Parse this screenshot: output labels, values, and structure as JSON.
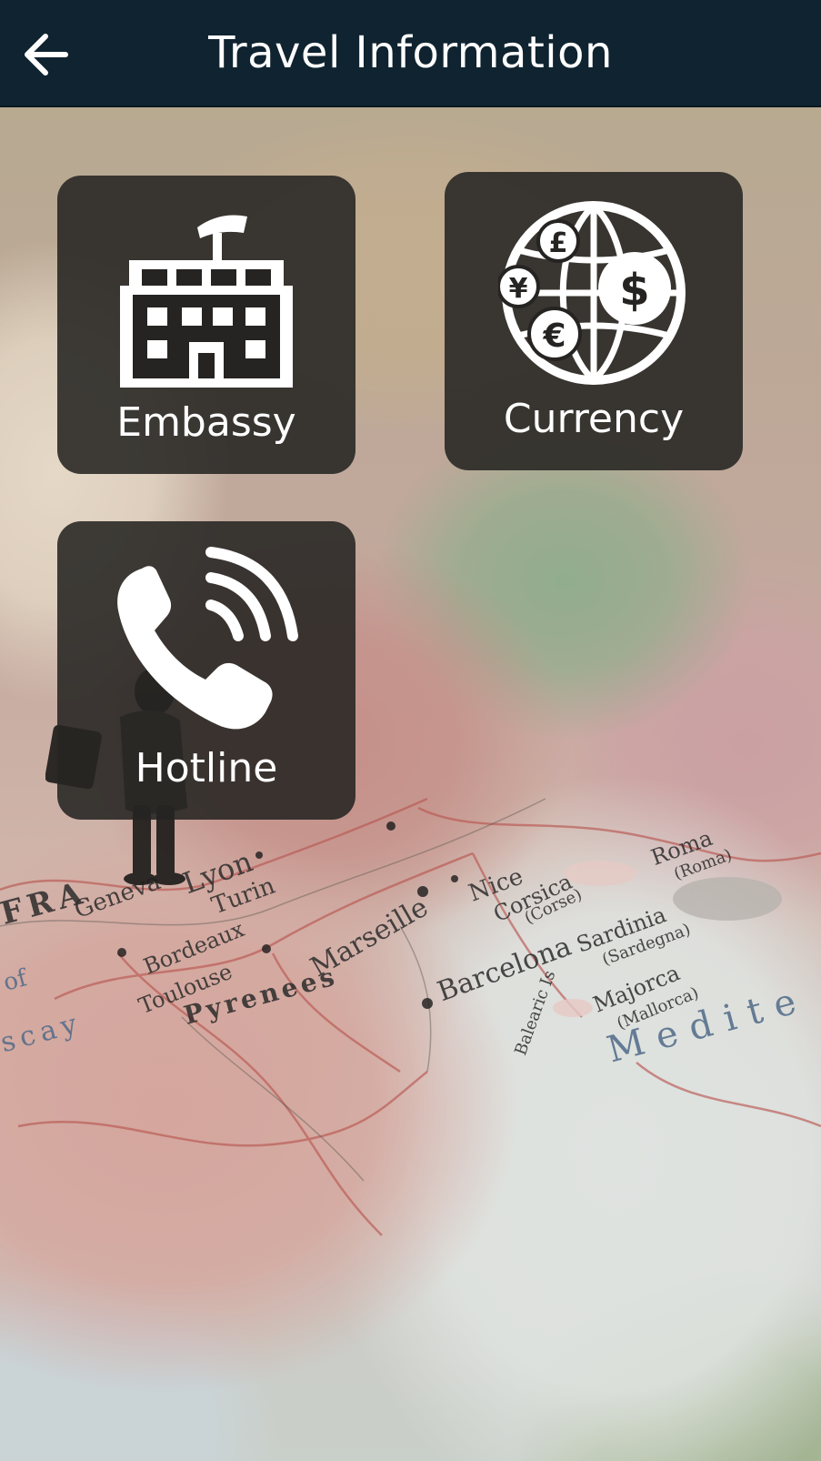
{
  "header": {
    "title": "Travel Information",
    "back_icon": "arrow-left-icon",
    "background_color": "#0f2330"
  },
  "tiles": [
    {
      "id": "embassy",
      "label": "Embassy",
      "icon": "building-icon"
    },
    {
      "id": "currency",
      "label": "Currency",
      "icon": "globe-currency-icon"
    },
    {
      "id": "hotline",
      "label": "Hotline",
      "icon": "phone-ringing-icon"
    }
  ],
  "background": {
    "map_labels": [
      "Geneva",
      "Lyon",
      "Turin",
      "Bordeaux",
      "Toulouse",
      "Marseille",
      "Nice",
      "Corsica",
      "(Corse)",
      "Barcelona",
      "Sardinia",
      "(Sardegna)",
      "Majorca",
      "(Mallorca)",
      "Balearic Is",
      "Pyrenees",
      "Medite",
      "Roma",
      "(Roma)",
      "FRA",
      "of",
      "scay"
    ]
  },
  "colors": {
    "tile_background": "#262422",
    "text": "#ffffff"
  }
}
